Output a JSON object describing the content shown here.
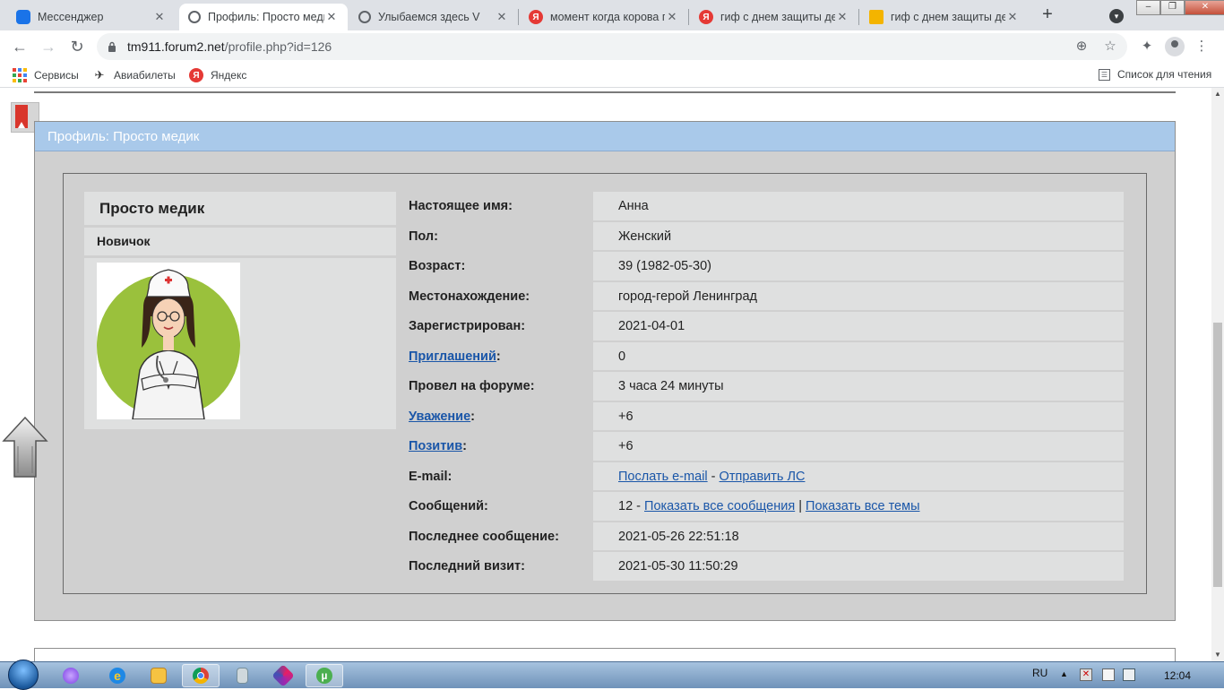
{
  "tabs": [
    {
      "title": "Мессенджер",
      "favicon_color": "#1a73e8",
      "favicon": "messenger-icon"
    },
    {
      "title": "Профиль: Просто медик",
      "favicon_color": "#5f6368",
      "favicon": "globe-icon",
      "active": true
    },
    {
      "title": "Улыбаемся здесь V",
      "favicon_color": "#5f6368",
      "favicon": "globe-icon"
    },
    {
      "title": "момент когда корова г",
      "favicon_color": "#e53935",
      "favicon": "yandex-icon",
      "letter": "Я"
    },
    {
      "title": "гиф с днем защиты детей",
      "favicon_color": "#e53935",
      "favicon": "yandex-icon",
      "letter": "Я"
    },
    {
      "title": "гиф с днем защиты детей",
      "favicon_color": "#f4b400",
      "favicon": "image-icon"
    }
  ],
  "toolbar": {
    "url_host": "tm911.forum2.net",
    "url_path": "/profile.php?id=126"
  },
  "bookmarks": [
    {
      "label": "Сервисы",
      "icon": "apps-icon"
    },
    {
      "label": "Авиабилеты",
      "icon": "plane-icon"
    },
    {
      "label": "Яндекс",
      "icon": "yandex-icon",
      "letter": "Я"
    }
  ],
  "reading_list": "Список для чтения",
  "profile": {
    "header": "Профиль: Просто медик",
    "username": "Просто медик",
    "user_title": "Новичок",
    "fields": [
      {
        "label": "Настоящее имя",
        "value": "Анна"
      },
      {
        "label": "Пол",
        "value": "Женский"
      },
      {
        "label": "Возраст",
        "value": "39 (1982-05-30)"
      },
      {
        "label": "Местонахождение",
        "value": "город-герой Ленинград"
      },
      {
        "label": "Зарегистрирован",
        "value": "2021-04-01"
      },
      {
        "label": "Приглашений",
        "value": "0",
        "label_link": true
      },
      {
        "label": "Провел на форуме",
        "value": "3 часа 24 минуты"
      },
      {
        "label": "Уважение",
        "value": "+6",
        "label_link": true
      },
      {
        "label": "Позитив",
        "value": "+6",
        "label_link": true
      },
      {
        "label": "E-mail",
        "value_parts": [
          {
            "text": "Послать e-mail",
            "link": true
          },
          {
            "text": " - "
          },
          {
            "text": "Отправить ЛС",
            "link": true
          }
        ]
      },
      {
        "label": "Сообщений",
        "value_parts": [
          {
            "text": "12 - "
          },
          {
            "text": "Показать все сообщения",
            "link": true
          },
          {
            "text": " | "
          },
          {
            "text": "Показать все темы",
            "link": true
          }
        ]
      },
      {
        "label": "Последнее сообщение",
        "value": "2021-05-26 22:51:18"
      },
      {
        "label": "Последний визит",
        "value": "2021-05-30 11:50:29"
      }
    ]
  },
  "taskbar": {
    "lang": "RU",
    "clock": "12:04"
  },
  "colors": {
    "panel_header": "#a9c9ea",
    "link": "#1a56a8",
    "avatar_circle": "#9ac13c"
  }
}
